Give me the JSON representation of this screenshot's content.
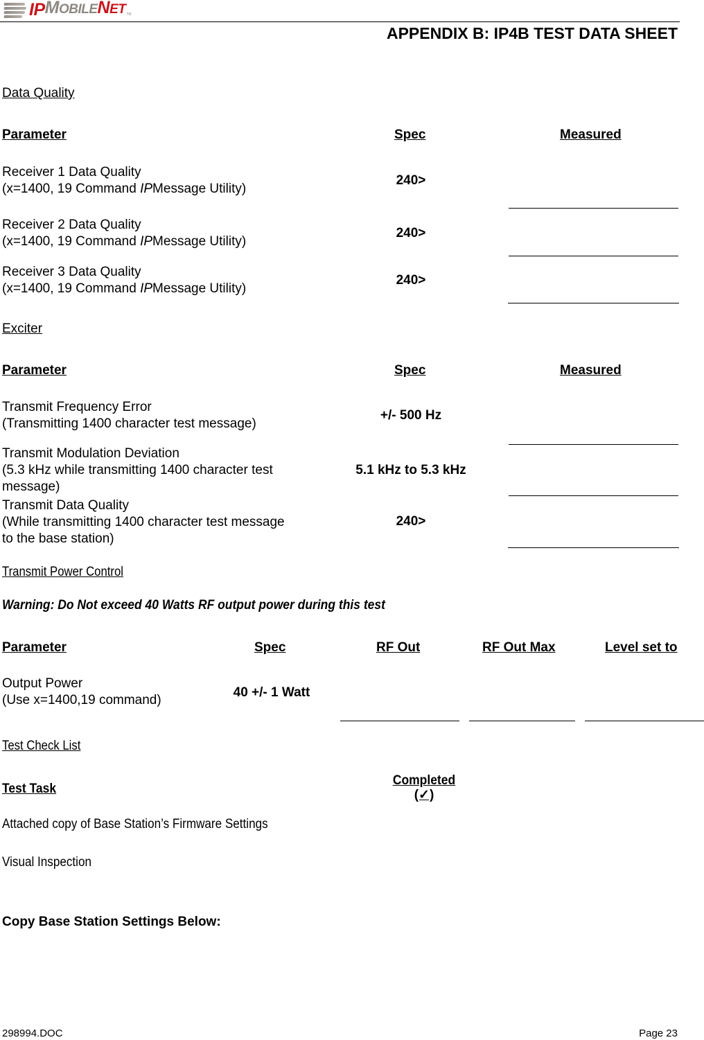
{
  "header": {
    "logo": {
      "ip": "IP",
      "mobile_first": "M",
      "mobile_rest": "OBILE",
      "net_first": "N",
      "net_rest": "ET",
      "tm": "TM"
    },
    "title": "APPENDIX B:  IP4B TEST DATA SHEET"
  },
  "colors": {
    "logo_red": "#c7161d",
    "logo_gray": "#8d8881",
    "text": "#000000"
  },
  "data_quality": {
    "section_title": "Data Quality",
    "columns": {
      "parameter": "Parameter",
      "spec": "Spec",
      "measured": "Measured"
    },
    "rows": [
      {
        "line1": "Receiver 1 Data Quality",
        "line2_pre": "(x=1400, 19 Command ",
        "line2_italic": "IP",
        "line2_post": "Message Utility)",
        "spec": "240>",
        "measured": ""
      },
      {
        "line1": "Receiver 2 Data Quality",
        "line2_pre": "(x=1400, 19 Command ",
        "line2_italic": "IP",
        "line2_post": "Message Utility)",
        "spec": "240>",
        "measured": ""
      },
      {
        "line1": "Receiver 3 Data Quality",
        "line2_pre": "(x=1400, 19 Command ",
        "line2_italic": "IP",
        "line2_post": "Message Utility)",
        "spec": "240>",
        "measured": ""
      }
    ]
  },
  "exciter": {
    "section_title": "Exciter",
    "columns": {
      "parameter": "Parameter",
      "spec": "Spec",
      "measured": "Measured"
    },
    "rows": [
      {
        "line1": "Transmit Frequency Error",
        "line2": "(Transmitting 1400 character test message)",
        "line3": "",
        "spec": "+/- 500 Hz",
        "measured": ""
      },
      {
        "line1": "Transmit Modulation Deviation",
        "line2": "(5.3 kHz while transmitting 1400 character test",
        "line3": "message)",
        "spec": "5.1 kHz to 5.3 kHz",
        "measured": ""
      },
      {
        "line1": "Transmit Data Quality",
        "line2": "(While transmitting 1400 character test message",
        "line3": "to the base station)",
        "spec": "240>",
        "measured": ""
      }
    ]
  },
  "power_control": {
    "section_title": "Transmit Power Control",
    "warning": "Warning: Do Not exceed 40 Watts RF output power during this test",
    "columns": {
      "parameter": "Parameter",
      "spec": "Spec",
      "rf_out": "RF Out",
      "rf_out_max": "RF Out Max",
      "level_set_to": "Level set to"
    },
    "rows": [
      {
        "line1": "Output Power",
        "line2": "(Use x=1400,19 command)",
        "spec": "40 +/- 1 Watt",
        "rf_out": "",
        "rf_out_max": "",
        "level_set_to": ""
      }
    ]
  },
  "checklist": {
    "section_title": "Test Check List",
    "columns": {
      "task": "Test Task",
      "completed_line1": "Completed",
      "completed_line2": "(✓)"
    },
    "items": [
      {
        "label": "Attached copy of Base Station’s Firmware Settings",
        "completed": ""
      },
      {
        "label": "Visual Inspection",
        "completed": ""
      }
    ]
  },
  "settings_heading": "Copy Base Station Settings Below:",
  "footer": {
    "doc_id": "298994.DOC",
    "page": "Page 23"
  }
}
